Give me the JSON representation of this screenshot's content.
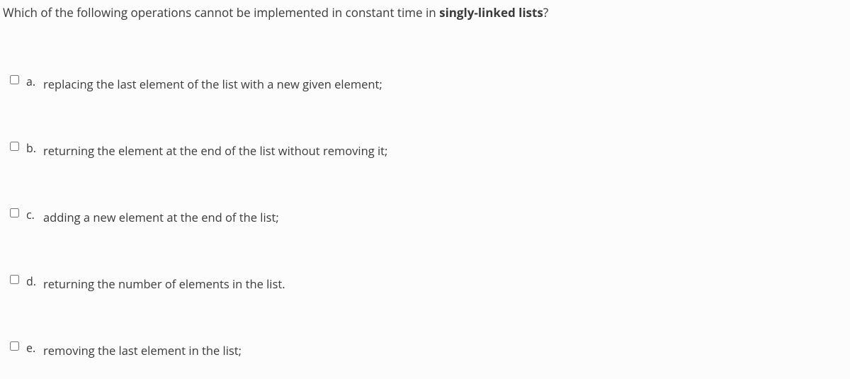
{
  "question": {
    "prefix": "Which of the following operations cannot be implemented in constant time in ",
    "bold": "singly-linked lists",
    "suffix": "?"
  },
  "options": [
    {
      "letter": "a.",
      "text": "replacing the last element of the list with a new given element;"
    },
    {
      "letter": "b.",
      "text": "returning the element at the end of the list without removing it;"
    },
    {
      "letter": "c.",
      "text": "adding a new element at the end of the list;"
    },
    {
      "letter": "d.",
      "text": "returning the number of elements in the list."
    },
    {
      "letter": "e.",
      "text": "removing the last element in the list;"
    }
  ]
}
